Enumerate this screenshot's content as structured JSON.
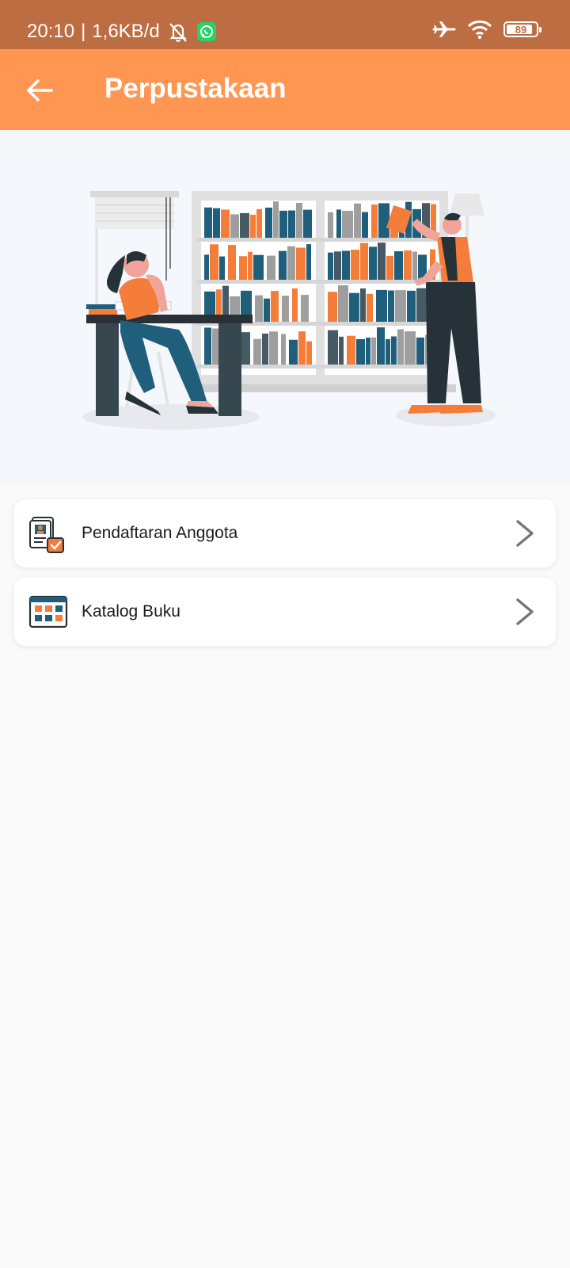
{
  "status_bar": {
    "time": "20:10",
    "separator": "|",
    "network_speed": "1,6KB/d",
    "battery": "89",
    "battery_level": 0.89,
    "icons": [
      "muted-bell-icon",
      "whatsapp-icon",
      "airplane-mode-icon",
      "wifi-icon",
      "battery-icon"
    ]
  },
  "app_bar": {
    "title": "Perpustakaan",
    "back_icon": "arrow-left-icon"
  },
  "menu": [
    {
      "label": "Pendaftaran Anggota",
      "icon": "member-registration-icon",
      "action_icon": "chevron-right-icon"
    },
    {
      "label": "Katalog Buku",
      "icon": "book-catalog-icon",
      "action_icon": "chevron-right-icon"
    }
  ],
  "colors": {
    "status_bar": "#bd6d42",
    "app_bar": "#ff9652",
    "accent_orange": "#f47d3a",
    "accent_teal": "#1f5f7c",
    "background": "#fafafa"
  }
}
